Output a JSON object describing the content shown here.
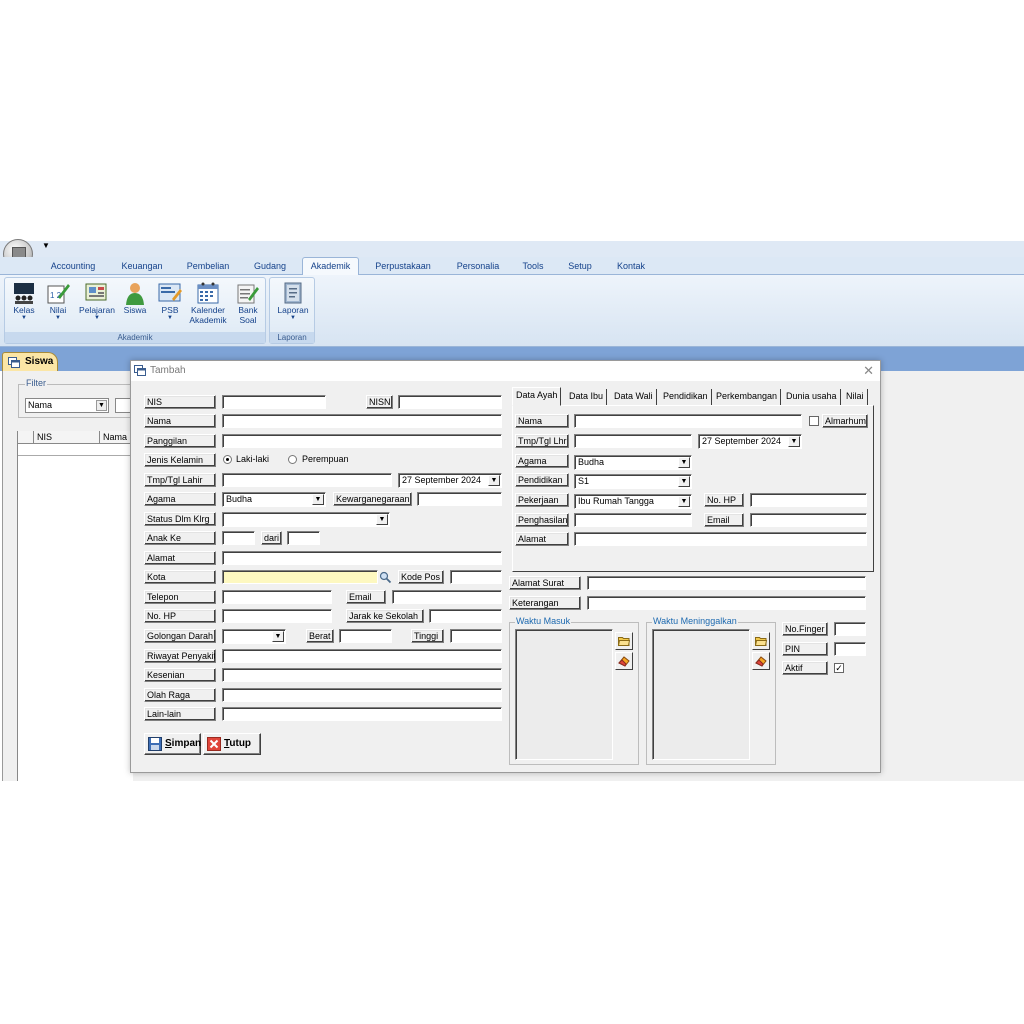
{
  "ribbon": {
    "tabs": [
      "Accounting",
      "Keuangan",
      "Pembelian",
      "Gudang",
      "Akademik",
      "Perpustakaan",
      "Personalia",
      "Tools",
      "Setup",
      "Kontak"
    ],
    "active_tab": "Akademik",
    "groups": {
      "akademik": {
        "label": "Akademik",
        "buttons": {
          "kelas": {
            "label": "Kelas",
            "icon": "classroom-icon"
          },
          "nilai": {
            "label": "Nilai",
            "icon": "grade-icon"
          },
          "pelajaran": {
            "label": "Pelajaran",
            "icon": "lesson-icon"
          },
          "siswa": {
            "label": "Siswa",
            "icon": "student-icon"
          },
          "psb": {
            "label": "PSB",
            "icon": "registration-icon"
          },
          "kalender": {
            "label1": "Kalender",
            "label2": "Akademik",
            "icon": "calendar-icon"
          },
          "banksoal": {
            "label1": "Bank",
            "label2": "Soal",
            "icon": "question-bank-icon"
          }
        }
      },
      "laporan": {
        "label": "Laporan",
        "buttons": {
          "laporan": {
            "label": "Laporan",
            "icon": "report-icon"
          }
        }
      }
    }
  },
  "doc_tab": {
    "label": "Siswa"
  },
  "filter": {
    "legend": "Filter",
    "field": "Nama"
  },
  "grid": {
    "columns": [
      "NIS",
      "Nama"
    ]
  },
  "dialog": {
    "title": "Tambah",
    "left": {
      "nis": "NIS",
      "nisn": "NISN",
      "nama": "Nama",
      "panggilan": "Panggilan",
      "jenis_kelamin": "Jenis Kelamin",
      "laki": "Laki-laki",
      "perempuan": "Perempuan",
      "tmp_tgl_lahir": "Tmp/Tgl Lahir",
      "tgl_lahir_value": "27 September 2024",
      "agama": "Agama",
      "agama_value": "Budha",
      "kewarganegaraan": "Kewarganegaraan",
      "status": "Status Dlm Klrg",
      "anak_ke": "Anak Ke",
      "dari": "dari",
      "alamat": "Alamat",
      "kota": "Kota",
      "kode_pos": "Kode Pos",
      "telepon": "Telepon",
      "email": "Email",
      "no_hp": "No. HP",
      "jarak": "Jarak ke Sekolah",
      "gol_darah": "Golongan Darah",
      "berat": "Berat",
      "tinggi": "Tinggi",
      "riwayat": "Riwayat Penyakit",
      "kesenian": "Kesenian",
      "olahraga": "Olah Raga",
      "lainlain": "Lain-lain"
    },
    "tabs": [
      "Data Ayah",
      "Data Ibu",
      "Data Wali",
      "Pendidikan",
      "Perkembangan",
      "Dunia usaha",
      "Nilai"
    ],
    "active_tab": "Data Ayah",
    "ayah": {
      "nama": "Nama",
      "almarhum": "Almarhum",
      "tmp_tgl_lhr": "Tmp/Tgl Lhr",
      "tgl_value": "27 September 2024",
      "agama": "Agama",
      "agama_value": "Budha",
      "pendidikan": "Pendidikan",
      "pendidikan_value": "S1",
      "pekerjaan": "Pekerjaan",
      "pekerjaan_value": "Ibu Rumah Tangga",
      "no_hp": "No. HP",
      "penghasilan": "Penghasilan",
      "email": "Email",
      "alamat": "Alamat"
    },
    "right": {
      "alamat_surat": "Alamat Surat",
      "keterangan": "Keterangan",
      "waktu_masuk": "Waktu Masuk",
      "waktu_meninggalkan": "Waktu Meninggalkan",
      "no_finger": "No.Finger",
      "pin": "PIN",
      "aktif": "Aktif"
    },
    "buttons": {
      "simpan_u": "S",
      "simpan_rest": "impan",
      "tutup_u": "T",
      "tutup_rest": "utup"
    }
  }
}
